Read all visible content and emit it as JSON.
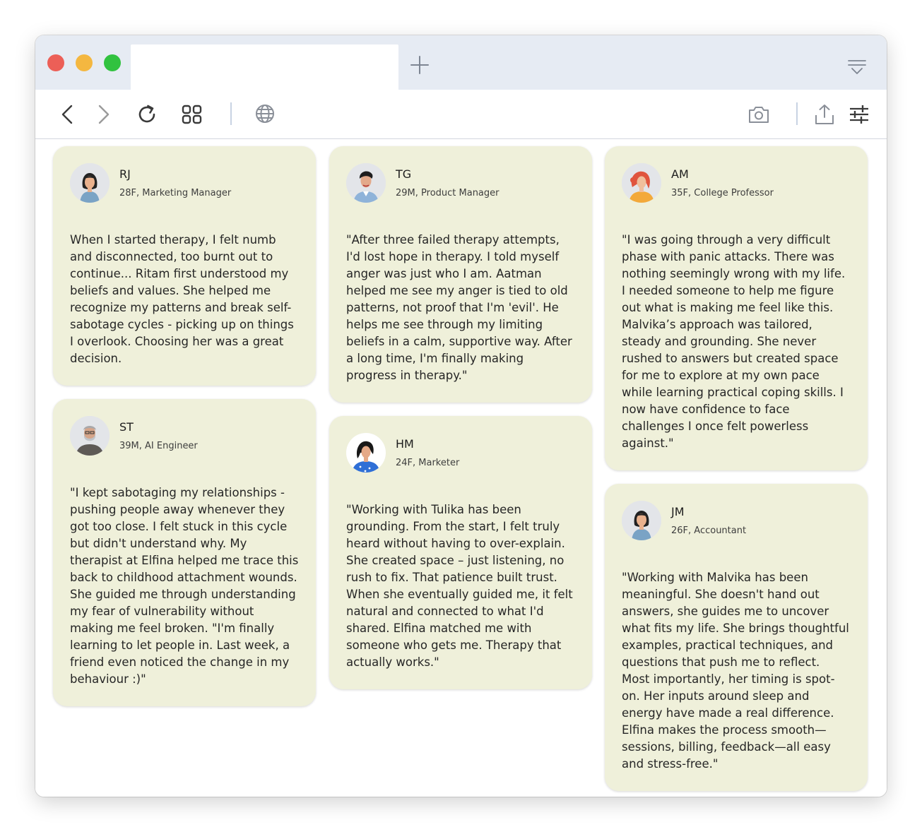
{
  "browser": {
    "tab_title": "",
    "icons": {
      "back": "chevron-left-icon",
      "forward": "chevron-right-icon",
      "reload": "reload-icon",
      "tabs": "grid-icon",
      "site": "globe-icon",
      "screenshot": "camera-icon",
      "share": "share-icon",
      "settings": "sliders-icon"
    }
  },
  "testimonials": [
    {
      "initials": "RJ",
      "meta": "28F, Marketing Manager",
      "quote": "When I started therapy, I felt numb and disconnected, too burnt out to continue... Ritam first understood my beliefs and values. She helped me recognize my patterns and break self-sabotage cycles - picking up on things I overlook. Choosing her was a great decision."
    },
    {
      "initials": "ST",
      "meta": "39M, AI Engineer",
      "quote": "\"I kept sabotaging my relationships - pushing people away whenever they got too close. I felt stuck in this cycle but didn't understand why. My therapist at Elfina helped me trace this back to childhood attachment wounds. She guided me through understanding my fear of vulnerability without making me feel broken. \"I'm finally learning to let people in. Last week, a friend even noticed the change in my behaviour :)\""
    },
    {
      "initials": "TG",
      "meta": "29M, Product Manager",
      "quote": "\"After three failed therapy attempts, I'd lost hope in therapy. I told myself anger was just who I am. Aatman helped me see my anger is tied to old patterns, not proof that I'm 'evil'. He helps me see through my limiting beliefs in a calm, supportive way. After a long time, I'm finally making progress in therapy.\""
    },
    {
      "initials": "HM",
      "meta": "24F, Marketer",
      "quote": "\"Working with Tulika has been grounding. From the start, I felt truly heard without having to over-explain. She created space – just listening, no rush to fix. That patience built trust. When she eventually guided me, it felt natural and connected to what I'd shared. Elfina matched me with someone who gets me. Therapy that actually works.\""
    },
    {
      "initials": "AM",
      "meta": "35F, College Professor",
      "quote": "\"I was going through a very difficult phase with panic attacks. There was nothing seemingly wrong with my life. I needed someone to help me figure out what is making me feel like this. Malvika’s approach was tailored, steady and grounding. She never rushed to answers but created space for me to explore at my own pace while learning practical coping skills. I now have confidence to face challenges I once felt powerless against.\""
    },
    {
      "initials": "JM",
      "meta": "26F, Accountant",
      "quote": "\"Working with Malvika has been meaningful. She doesn't hand out answers, she guides me to uncover what fits my life. She brings thoughtful examples, practical techniques, and questions that push me to reflect. Most importantly, her timing is spot-on. Her inputs around sleep and energy have made a real difference. Elfina makes the process smooth—sessions, billing, feedback—all easy and stress-free.\""
    }
  ]
}
